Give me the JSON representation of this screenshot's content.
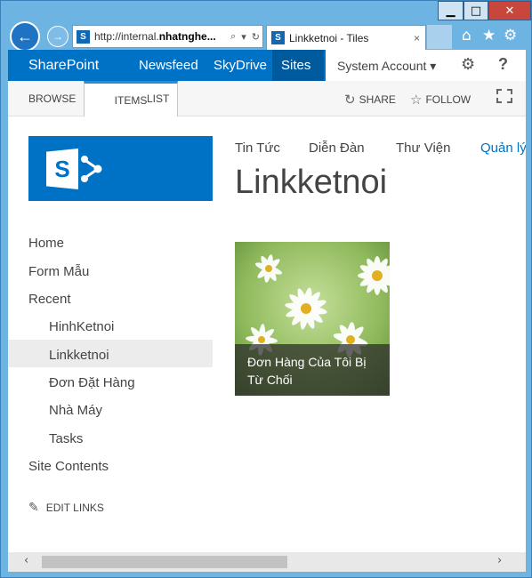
{
  "browser": {
    "address_url_prefix": "http://internal.",
    "address_url_host": "nhatnghe...",
    "tab_title": "Linkketnoi - Tiles",
    "tab_close": "×",
    "window_minimize": "▁",
    "window_maximize": "□",
    "window_close": "✕",
    "home_icon": "⌂",
    "favorites_icon": "★",
    "tools_icon": "⚙"
  },
  "suitebar": {
    "brand": "SharePoint",
    "links": [
      "Newsfeed",
      "SkyDrive",
      "Sites"
    ],
    "user": "System Account ▾",
    "gear": "⚙",
    "help": "?"
  },
  "ribbon": {
    "tabs": [
      "BROWSE",
      "ITEMS",
      "LIST"
    ],
    "share": "SHARE",
    "follow": "FOLLOW"
  },
  "topnav": [
    "Tin Tức",
    "Diễn Đàn",
    "Thư Viện",
    "Quản lý"
  ],
  "page_title": "Linkketnoi",
  "quicklaunch": {
    "items": [
      "Home",
      "Form Mẫu",
      "Recent"
    ],
    "recent": [
      "HinhKetnoi",
      "Linkketnoi",
      "Đơn Đặt Hàng",
      "Nhà Máy",
      "Tasks"
    ],
    "site_contents": "Site Contents",
    "edit_links": "EDIT LINKS"
  },
  "tiles": [
    {
      "caption": "Đơn Hàng Của Tôi Bị Từ Chối"
    }
  ],
  "colors": {
    "suite_blue": "#0072c6",
    "suite_active": "#005a9e",
    "window_chrome": "#6db4e2"
  }
}
